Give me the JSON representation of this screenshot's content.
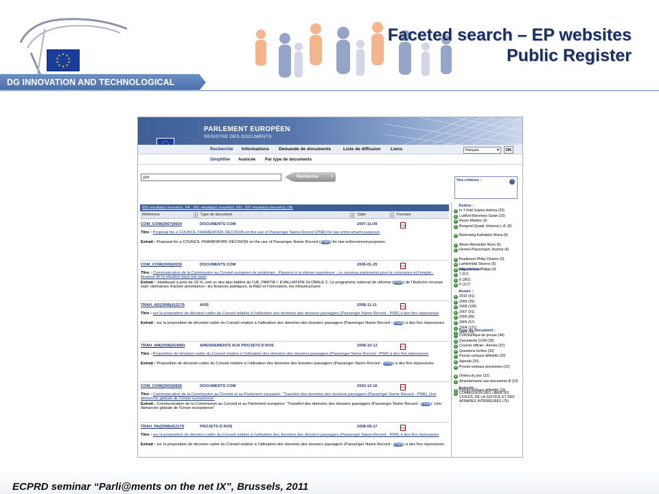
{
  "slide": {
    "title_line1": "Faceted search – EP websites",
    "title_line2": "Public Register",
    "banner": "DG INNOVATION AND TECHNOLOGICAL SUPPORT",
    "footer": "ECPRD seminar “Parli@ments on the net IX”, Brussels, 2011"
  },
  "ep": {
    "name": "PARLEMENT EUROPÉEN",
    "subtitle": "REGISTRE DES DOCUMENTS",
    "nav": [
      "Recherche",
      "Informations",
      "Demande de documents",
      "Liste de diffusion",
      "Liens"
    ],
    "subnav": [
      "Simplifiée",
      "Avancée",
      "Par type de documents"
    ],
    "language": "français",
    "ok": "OK",
    "search_value": "pnr",
    "search_button": "Recherche",
    "search_plus": "+",
    "results_summary": "555 résultat(s) trouvé(s), FR ; 561 résultat(s) trouvé(s), EN ; 337 résultat(s) trouvé(s), DE",
    "columns": [
      "Référence",
      "Type de document",
      "Date",
      "Formats"
    ],
    "criteria_label": "Vos critères :"
  },
  "results": [
    {
      "ref": "COM_COM(2007)0654",
      "type": "DOCUMENTS COM",
      "date": "2007-11-09",
      "titre_label": "Titre :",
      "titre": "Proposal for a COUNCIL FRAMEWORK DECISION on the use of Passenger Name Record (PNR) for law enforcement purposes",
      "extrait_label": "Extrait :",
      "extrait_before": "Proposal for a COUNCIL FRAMEWORK DECISION on the use of Passenger Name Record (",
      "extrait_hl": "PNR",
      "extrait_after": ") for law enforcement purposes"
    },
    {
      "ref": "COM_COM(2006)0030",
      "type": "DOCUMENTS COM",
      "date": "2006-01-25",
      "titre_label": "Titre :",
      "titre": "Communication de la Commission au Conseil européen de printemps : Passons à la vitesse supérieure - Le nouveau partenariat pour la croissance et l'emploi - Analyse de la situation pays par pays",
      "extrait_label": "Extrait :",
      "extrait_before": "'établissait à près de 29 %, soit un des plus faibles de l'UE. PARTIE I: EVALUATION GLOBALE 2. Le programme national de réforme (",
      "extrait_hl": "PNR",
      "extrait_after": ") de l'Autriche recense sept «domaines d'action prioritaires»: les finances publiques, la R&D et l'innovation, les infrastructures"
    },
    {
      "ref": "TRAH_AD(2008)412179",
      "type": "AVIS",
      "date": "2008-11-11",
      "titre_label": "Titre :",
      "titre": "sur la proposition de décision-cadre du Conseil relative à l'utilisation des données des dossiers passagers (Passenger Name Record - PNR) à des fins répressives",
      "extrait_label": "Extrait :",
      "extrait_before": "sur la proposition de décision-cadre du Conseil relative à l'utilisation des données des dossiers passagers (Passenger Name Record - ",
      "extrait_hl": "PNR",
      "extrait_after": ") à des fins répressives"
    },
    {
      "ref": "TRAH_AM(2008)414083",
      "type": "AMENDEMENTS AUX PROJETS D'AVIS",
      "date": "2008-10-13",
      "titre_label": "Titre :",
      "titre": "Proposition de décision-cadre du Conseil relative à l'utilisation des données des dossiers passagers (Passenger Name Record - PNR) à des fins répressives",
      "extrait_label": "Extrait :",
      "extrait_before": "Proposition de décision-cadre du Conseil relative à l'utilisation des données des dossiers passagers (Passenger Name Record - ",
      "extrait_hl": "PNR",
      "extrait_after": ") à des fins répressives"
    },
    {
      "ref": "COM_COM(2003)0826",
      "type": "DOCUMENTS COM",
      "date": "2003-12-16",
      "titre_label": "Titre :",
      "titre": "Communication de la Commission au Conseil et au Parlement européen: \"Transfert des données des dossiers passagers (Passenger Name Record - PNR): Une démarche globale de l'Union européenne\"",
      "extrait_label": "Extrait :",
      "extrait_before": "Communication de la Commission au Conseil et au Parlement européen: \"Transfert des données des dossiers passagers (Passenger Name Record - ",
      "extrait_hl": "PNR",
      "extrait_after": "): Une démarche globale de l'Union européenne\""
    },
    {
      "ref": "TRAH_PA(2008)412179",
      "type": "PROJETS D'AVIS",
      "date": "2008-09-17",
      "titre_label": "Titre :",
      "titre": "sur la proposition de décision-cadre du Conseil relative à l'utilisation des données des dossiers passagers (Passenger Name Record - PNR) à des fins répressives",
      "extrait_label": "Extrait :",
      "extrait_before": "sur la proposition de décision-cadre du Conseil relative à l'utilisation des données des dossiers passagers (Passenger Name Record - ",
      "extrait_hl": "PNR",
      "extrait_after": ") à des fins répressives"
    }
  ],
  "facets": {
    "auteur_title": "Auteur :",
    "auteur": [
      "In 't Veld Sophia Helena (29)",
      "Ludford Baroness Sarah (15)",
      "Roure Martine (9)",
      "Boogerd-Quaak Johanna L.A. (8)",
      "Buitenweg Kathalijne Maria (8)",
      "Alvaro Alexander Nuno (6)",
      "Hennis-Plasschaert Jeanine (6)",
      "Bradbourn Philip Charles (5)",
      "Lambrinidis Stavros (5)",
      "Albrecht Jan Philipp (4)"
    ],
    "legislature_title": "Législature :",
    "legislature": [
      "7 (57)",
      "6 (381)",
      "5 (117)"
    ],
    "annee_title": "Année :",
    "annee": [
      "2010 (41)",
      "2009 (35)",
      "2008 (109)",
      "2007 (91)",
      "2006 (85)",
      "2005 (57)",
      "2004 (121)",
      "2003 (16)"
    ],
    "type_title": "Type de document :",
    "type": [
      "Communiqué de presse (44)",
      "Documents COM (39)",
      "Courrier officiel - Arrivée (37)",
      "Questions écrites (33)",
      "Procès-verbaux définitifs (29)",
      "Agenda (26)",
      "Procès-verbaux provisoires (22)",
      "Ordres du jour (22)",
      "Amendements aux documents B (19)",
      "Procès-verbaux définitifs (16)"
    ],
    "autorite_title": "Autorité :",
    "autorite": [
      "COMMISSION DES LIBERTÉS CIVILES, DE LA JUSTICE ET DES AFFAIRES INTÉRIEURES (75)"
    ]
  }
}
